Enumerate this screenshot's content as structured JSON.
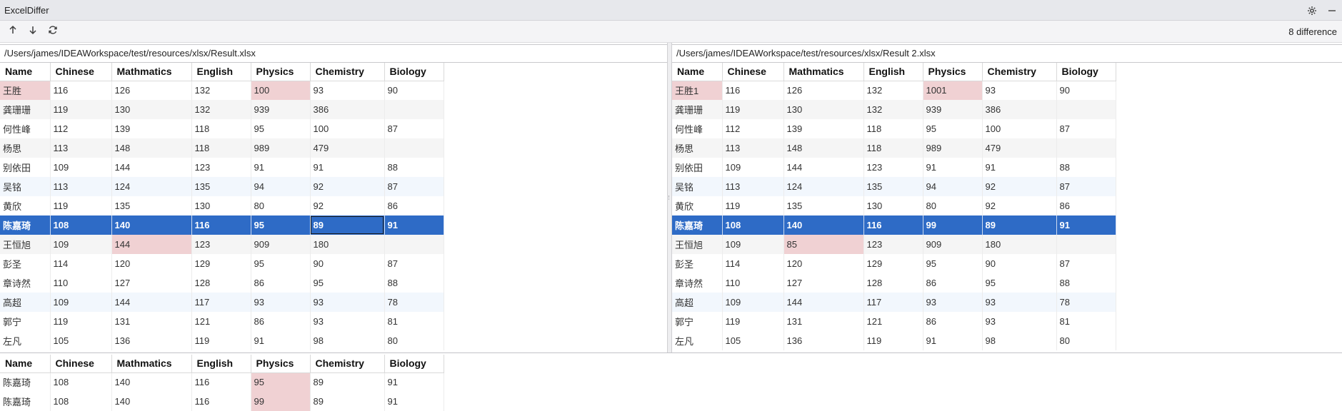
{
  "window": {
    "title": "ExcelDiffer"
  },
  "toolbar": {
    "difference_count": "8 difference"
  },
  "columns": [
    "Name",
    "Chinese",
    "Mathmatics",
    "English",
    "Physics",
    "Chemistry",
    "Biology"
  ],
  "left": {
    "path": "/Users/james/IDEAWorkspace/test/resources/xlsx/Result.xlsx",
    "rows": [
      [
        "王胜",
        "116",
        "126",
        "132",
        "100",
        "93",
        "90"
      ],
      [
        "龚珊珊",
        "119",
        "130",
        "132",
        "939",
        "386",
        ""
      ],
      [
        "何性峰",
        "112",
        "139",
        "118",
        "95",
        "100",
        "87"
      ],
      [
        "杨思",
        "113",
        "148",
        "118",
        "989",
        "479",
        ""
      ],
      [
        "别依田",
        "109",
        "144",
        "123",
        "91",
        "91",
        "88"
      ],
      [
        "吴铭",
        "113",
        "124",
        "135",
        "94",
        "92",
        "87"
      ],
      [
        "黄欣",
        "119",
        "135",
        "130",
        "80",
        "92",
        "86"
      ],
      [
        "陈嘉琦",
        "108",
        "140",
        "116",
        "95",
        "89",
        "91"
      ],
      [
        "王恒旭",
        "109",
        "144",
        "123",
        "909",
        "180",
        ""
      ],
      [
        "彭圣",
        "114",
        "120",
        "129",
        "95",
        "90",
        "87"
      ],
      [
        "章诗然",
        "110",
        "127",
        "128",
        "86",
        "95",
        "88"
      ],
      [
        "高超",
        "109",
        "144",
        "117",
        "93",
        "93",
        "78"
      ],
      [
        "郭宁",
        "119",
        "131",
        "121",
        "86",
        "93",
        "81"
      ],
      [
        "左凡",
        "105",
        "136",
        "119",
        "91",
        "98",
        "80"
      ]
    ]
  },
  "right": {
    "path": "/Users/james/IDEAWorkspace/test/resources/xlsx/Result 2.xlsx",
    "rows": [
      [
        "王胜1",
        "116",
        "126",
        "132",
        "1001",
        "93",
        "90"
      ],
      [
        "龚珊珊",
        "119",
        "130",
        "132",
        "939",
        "386",
        ""
      ],
      [
        "何性峰",
        "112",
        "139",
        "118",
        "95",
        "100",
        "87"
      ],
      [
        "杨思",
        "113",
        "148",
        "118",
        "989",
        "479",
        ""
      ],
      [
        "别依田",
        "109",
        "144",
        "123",
        "91",
        "91",
        "88"
      ],
      [
        "吴铭",
        "113",
        "124",
        "135",
        "94",
        "92",
        "87"
      ],
      [
        "黄欣",
        "119",
        "135",
        "130",
        "80",
        "92",
        "86"
      ],
      [
        "陈嘉琦",
        "108",
        "140",
        "116",
        "99",
        "89",
        "91"
      ],
      [
        "王恒旭",
        "109",
        "85",
        "123",
        "909",
        "180",
        ""
      ],
      [
        "彭圣",
        "114",
        "120",
        "129",
        "95",
        "90",
        "87"
      ],
      [
        "章诗然",
        "110",
        "127",
        "128",
        "86",
        "95",
        "88"
      ],
      [
        "高超",
        "109",
        "144",
        "117",
        "93",
        "93",
        "78"
      ],
      [
        "郭宁",
        "119",
        "131",
        "121",
        "86",
        "93",
        "81"
      ],
      [
        "左凡",
        "105",
        "136",
        "119",
        "91",
        "98",
        "80"
      ]
    ]
  },
  "bottom": {
    "rows": [
      [
        "陈嘉琦",
        "108",
        "140",
        "116",
        "95",
        "89",
        "91"
      ],
      [
        "陈嘉琦",
        "108",
        "140",
        "116",
        "99",
        "89",
        "91"
      ]
    ]
  },
  "highlight": {
    "diff_color": "#f0d1d3",
    "selection_color": "#2e6bc6"
  }
}
